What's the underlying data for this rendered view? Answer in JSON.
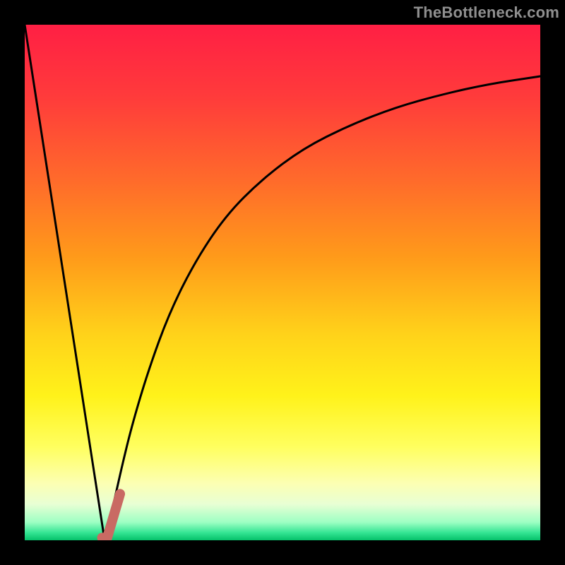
{
  "watermark": "TheBottleneck.com",
  "colors": {
    "gradient_stops": [
      {
        "offset": 0.0,
        "color": "#ff1f44"
      },
      {
        "offset": 0.14,
        "color": "#ff3b3b"
      },
      {
        "offset": 0.3,
        "color": "#ff6a2b"
      },
      {
        "offset": 0.45,
        "color": "#ff9a1a"
      },
      {
        "offset": 0.6,
        "color": "#ffd21a"
      },
      {
        "offset": 0.72,
        "color": "#fff21a"
      },
      {
        "offset": 0.82,
        "color": "#ffff60"
      },
      {
        "offset": 0.89,
        "color": "#fcffb3"
      },
      {
        "offset": 0.93,
        "color": "#e8ffd4"
      },
      {
        "offset": 0.965,
        "color": "#9dffc3"
      },
      {
        "offset": 0.985,
        "color": "#35e594"
      },
      {
        "offset": 1.0,
        "color": "#05c16a"
      }
    ],
    "curve": "#000000",
    "marker": "#c96a63",
    "background": "#000000"
  },
  "chart_data": {
    "type": "line",
    "title": "",
    "xlabel": "",
    "ylabel": "",
    "xlim": [
      0,
      100
    ],
    "ylim": [
      0,
      100
    ],
    "grid": false,
    "series": [
      {
        "name": "left-line",
        "x": [
          0.0,
          15.5
        ],
        "y": [
          100.0,
          0.0
        ]
      },
      {
        "name": "right-curve",
        "x": [
          15.5,
          17,
          19,
          21,
          24,
          28,
          33,
          39,
          46,
          54,
          63,
          72,
          81,
          90,
          100
        ],
        "y": [
          0.0,
          6,
          15,
          23,
          33,
          44,
          54,
          63,
          70,
          76,
          80.5,
          84,
          86.5,
          88.5,
          90
        ]
      }
    ],
    "annotations": [
      {
        "name": "marker-hook",
        "shape": "L-stroke",
        "x": [
          15.0,
          16.0,
          18.5
        ],
        "y": [
          0.5,
          0.5,
          9.0
        ]
      }
    ]
  }
}
